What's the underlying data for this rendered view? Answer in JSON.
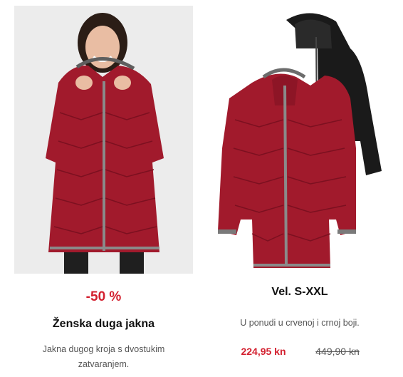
{
  "colors": {
    "accent_red": "#d3202f",
    "jacket_red": "#a11a2c",
    "jacket_black": "#1a1a1a",
    "text_gray": "#555555"
  },
  "product_left": {
    "image": "red-jacket-model-photo",
    "discount_label": "-50 %",
    "title": "Ženska duga jakna",
    "description_line1": "Jakna dugog kroja s dvostukim",
    "description_line2": "zatvaranjem."
  },
  "product_right": {
    "image": "red-and-black-jackets-photo",
    "size_label": "Vel. S-XXL",
    "description": "U ponudi u crvenoj i crnoj boji.",
    "price_new": "224,95 kn",
    "price_old": "449,90 kn"
  }
}
